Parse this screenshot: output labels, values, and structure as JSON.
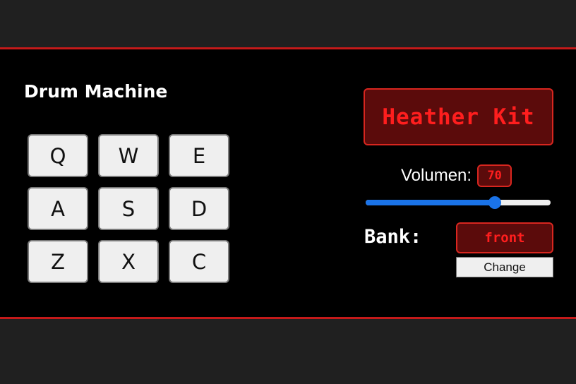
{
  "app": {
    "title": "Drum Machine"
  },
  "pads": [
    {
      "key": "Q"
    },
    {
      "key": "W"
    },
    {
      "key": "E"
    },
    {
      "key": "A"
    },
    {
      "key": "S"
    },
    {
      "key": "D"
    },
    {
      "key": "Z"
    },
    {
      "key": "X"
    },
    {
      "key": "C"
    }
  ],
  "display": {
    "text": "Heather Kit"
  },
  "volume": {
    "label": "Volumen:",
    "value": "70",
    "level": 0.7,
    "accent_color": "#1a73e8"
  },
  "bank": {
    "label": "Bank:",
    "value": "front",
    "change_label": "Change"
  },
  "colors": {
    "background": "#202020",
    "panel": "#000000",
    "border": "#c41a1a",
    "display_bg": "#5b0b0b",
    "display_text": "#ff1e1e",
    "pad_bg": "#efefef"
  }
}
